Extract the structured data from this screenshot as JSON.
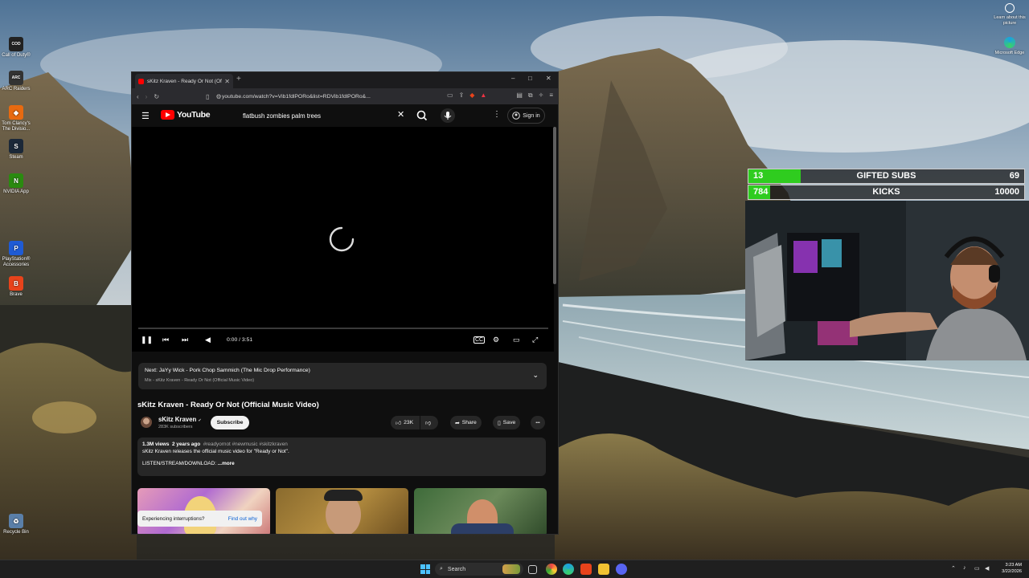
{
  "desktop": {
    "icons": [
      {
        "label": "Call of Duty®",
        "glyph": "COD",
        "color": "#222222"
      },
      {
        "label": "ARC Raiders",
        "glyph": "ARC",
        "color": "#333333"
      },
      {
        "label": "Tom Clancy's The Divisio...",
        "glyph": "◆",
        "color": "#e86a10"
      },
      {
        "label": "Steam",
        "glyph": "S",
        "color": "#1b2838"
      },
      {
        "label": "NVIDIA App",
        "glyph": "N",
        "color": "#2a8a10"
      },
      {
        "label": "PlayStation® Accessories",
        "glyph": "P",
        "color": "#1f5bd4"
      },
      {
        "label": "Brave",
        "glyph": "B",
        "color": "#e8431b"
      },
      {
        "label": "Recycle Bin",
        "glyph": "♻",
        "color": "#5a7fa8"
      }
    ],
    "learn_label": "Learn about this picture",
    "edge_label": "Microsoft Edge"
  },
  "browser": {
    "tab_title": "sKitz Kraven - Ready Or Not (Of",
    "new_tab": "+",
    "url": "youtube.com/watch?v=Vib1fdlPORo&list=RDVib1fdlPORo&...",
    "window_controls": [
      "–",
      "□",
      "✕"
    ]
  },
  "youtube": {
    "logo_text": "YouTube",
    "search_query": "flatbush zombies palm trees",
    "signin_label": "Sign in",
    "player": {
      "time": "0:00 / 3:51",
      "progress": 0
    },
    "next": {
      "title": "Next: JaYy Wick - Pork Chop Sammich (The Mic Drop Performance)",
      "subtitle": "Mix - sKitz Kraven - Ready Or Not (Official Music Video)"
    },
    "video_title": "sKitz Kraven - Ready Or Not (Official Music Video)",
    "channel": {
      "name": "sKitz Kraven",
      "verified": "✔",
      "subscribers": "283K subscribers",
      "subscribe_label": "Subscribe"
    },
    "actions": {
      "likes": "23K",
      "share": "Share",
      "save": "Save",
      "more": "•••"
    },
    "description": {
      "views": "1.3M views",
      "age": "2 years ago",
      "tags": "#readyornot #newmusic #skitzkraven",
      "line1": "sKitz Kraven releases the official music video for \"Ready or Not\".",
      "line2": "LISTEN/STREAM/DOWNLOAD:",
      "more": "...more"
    },
    "toast": {
      "text": "Experiencing interruptions?",
      "link": "Find out why"
    }
  },
  "overlay": {
    "goals": [
      {
        "current": "13",
        "label": "GIFTED SUBS",
        "target": "69",
        "fraction": 0.19
      },
      {
        "current": "784",
        "label": "KICKS",
        "target": "10000",
        "fraction": 0.08
      }
    ]
  },
  "taskbar": {
    "search_label": "Search",
    "time": "3:23 AM",
    "date": "3/22/2026"
  },
  "colors": {
    "youtube_red": "#ff0000",
    "goal_green": "#2fcc1f",
    "link_blue": "#065fd4"
  }
}
